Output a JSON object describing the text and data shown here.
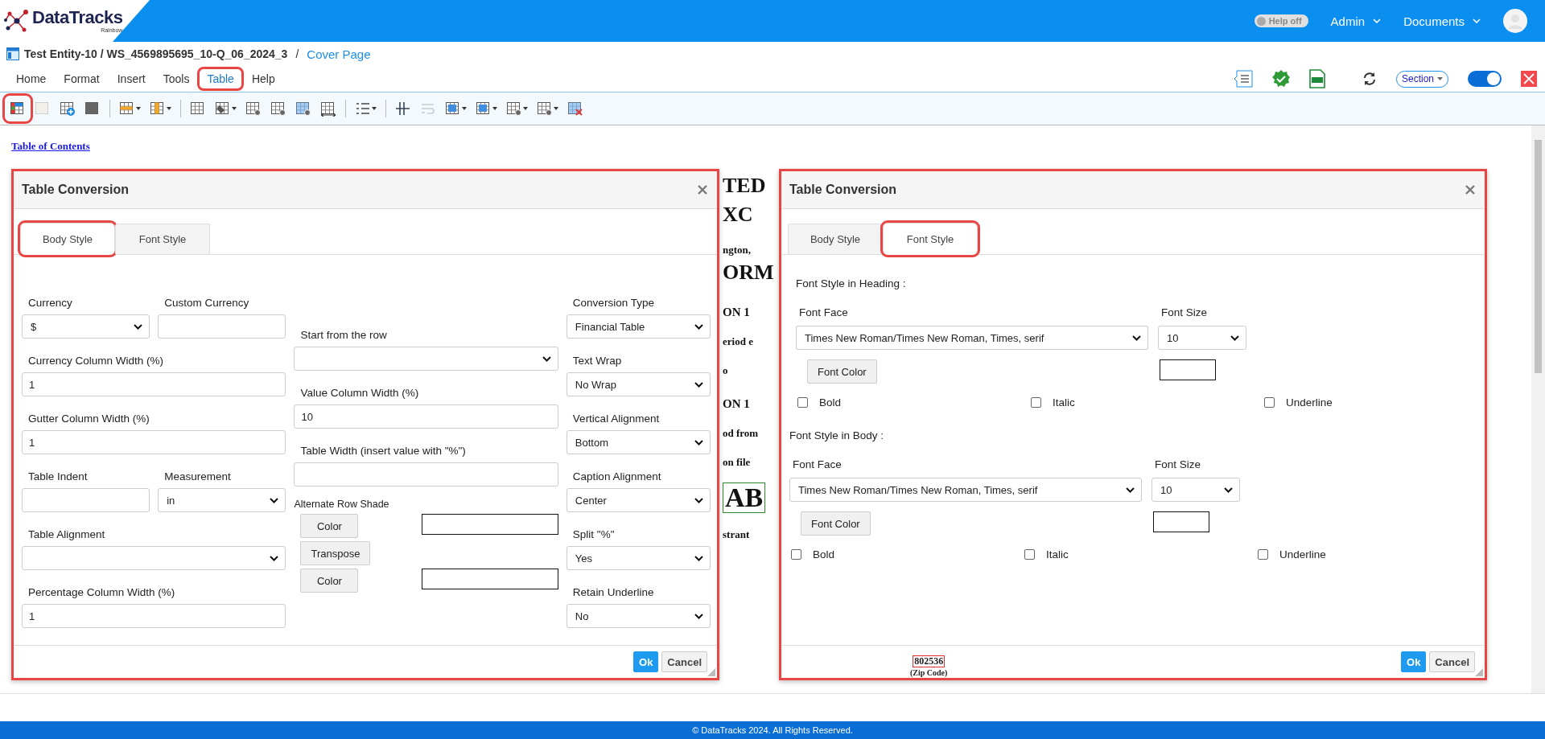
{
  "header": {
    "logo": "DataTracks",
    "logo_sub": "Rainbow",
    "help_toggle": {
      "label": "Help off",
      "on": false
    },
    "menus": [
      "Admin",
      "Documents"
    ]
  },
  "breadcrumb": {
    "path": "Test Entity-10 / WS_4569895695_10-Q_06_2024_3",
    "separator": "/",
    "current": "Cover Page"
  },
  "menu": [
    {
      "label": "Home",
      "selected": false,
      "annotated": false
    },
    {
      "label": "Format",
      "selected": false,
      "annotated": false
    },
    {
      "label": "Insert",
      "selected": false,
      "annotated": false
    },
    {
      "label": "Tools",
      "selected": false,
      "annotated": false
    },
    {
      "label": "Table",
      "selected": true,
      "annotated": true
    },
    {
      "label": "Help",
      "selected": false,
      "annotated": false
    }
  ],
  "right_tools": {
    "section": "Section",
    "toggle_on": true
  },
  "toolbar": {
    "groups": [
      [
        {
          "dropdown": false,
          "disabled": false,
          "annotated": true
        },
        {
          "dropdown": false,
          "disabled": true,
          "annotated": false
        },
        {
          "dropdown": false,
          "disabled": false,
          "annotated": false
        },
        {
          "dropdown": false,
          "disabled": false,
          "annotated": false
        }
      ],
      [
        {
          "dropdown": true,
          "disabled": false,
          "annotated": false
        },
        {
          "dropdown": true,
          "disabled": false,
          "annotated": false
        }
      ],
      [
        {
          "dropdown": false,
          "disabled": false,
          "annotated": false
        },
        {
          "dropdown": true,
          "disabled": false,
          "annotated": false
        },
        {
          "dropdown": false,
          "disabled": false,
          "annotated": false
        },
        {
          "dropdown": false,
          "disabled": false,
          "annotated": false
        },
        {
          "dropdown": false,
          "disabled": false,
          "annotated": false
        },
        {
          "dropdown": false,
          "disabled": false,
          "annotated": false
        }
      ],
      [
        {
          "dropdown": true,
          "disabled": false,
          "annotated": false
        }
      ],
      [
        {
          "dropdown": false,
          "disabled": false,
          "annotated": false
        },
        {
          "dropdown": false,
          "disabled": true,
          "annotated": false
        },
        {
          "dropdown": true,
          "disabled": false,
          "annotated": false
        },
        {
          "dropdown": true,
          "disabled": false,
          "annotated": false
        },
        {
          "dropdown": true,
          "disabled": false,
          "annotated": false
        },
        {
          "dropdown": true,
          "disabled": false,
          "annotated": false
        },
        {
          "dropdown": false,
          "disabled": false,
          "annotated": false
        }
      ]
    ]
  },
  "document": {
    "toc_link": "Table of Contents",
    "fragments": [
      {
        "text": "TED",
        "kind": "title"
      },
      {
        "text": "XC",
        "kind": "title"
      },
      {
        "text": "ngton,",
        "kind": "line"
      },
      {
        "text": "ORM",
        "kind": "title"
      },
      {
        "text": "ON 1",
        "kind": "subtitle"
      },
      {
        "text": "eriod e",
        "kind": "line"
      },
      {
        "text": "o",
        "kind": "line"
      },
      {
        "text": "ON 1",
        "kind": "subtitle"
      },
      {
        "text": "od from",
        "kind": "line"
      },
      {
        "text": "on file",
        "kind": "line"
      },
      {
        "text": "AB",
        "kind": "boxed"
      },
      {
        "text": "strant",
        "kind": "line"
      }
    ],
    "zip": "802536",
    "zip_label": "(Zip Code)"
  },
  "dialogs": [
    {
      "kind": "body",
      "title": "Table Conversion",
      "annotated": true,
      "tabs": [
        {
          "label": "Body Style",
          "selected": true,
          "annotated": true
        },
        {
          "label": "Font Style",
          "selected": false,
          "annotated": false
        }
      ],
      "columns": [
        [
          [
            {
              "kind": "select",
              "label": "Currency",
              "value": "$"
            },
            {
              "kind": "input",
              "label": "Custom Currency"
            }
          ],
          [
            {
              "kind": "input",
              "label": "Currency Column Width (%)",
              "value": "1"
            }
          ],
          [
            {
              "kind": "input",
              "label": "Gutter Column Width (%)",
              "value": "1"
            }
          ],
          [
            {
              "kind": "input",
              "label": "Table Indent"
            },
            {
              "kind": "select",
              "label": "Measurement",
              "value": "in"
            }
          ],
          [
            {
              "kind": "select",
              "label": "Table Alignment"
            }
          ],
          [
            {
              "kind": "input",
              "label": "Percentage Column Width (%)",
              "value": "1"
            }
          ]
        ],
        [
          [
            {
              "kind": "select",
              "label": "Start from the row"
            }
          ],
          [
            {
              "kind": "input",
              "label": "Value Column Width (%)",
              "value": "10"
            }
          ],
          [
            {
              "kind": "input",
              "label": "Table Width (insert value with \"%\")"
            }
          ],
          [
            {
              "kind": "caption",
              "label": "Alternate Row Shade"
            }
          ],
          [
            {
              "kind": "button",
              "value": "Color"
            },
            {
              "kind": "swatch"
            }
          ],
          [
            {
              "kind": "button",
              "value": "Transpose"
            }
          ],
          [
            {
              "kind": "button",
              "value": "Color"
            },
            {
              "kind": "swatch"
            }
          ]
        ],
        [
          [
            {
              "kind": "select",
              "label": "Conversion Type",
              "value": "Financial Table"
            }
          ],
          [
            {
              "kind": "select",
              "label": "Text Wrap",
              "value": "No Wrap"
            }
          ],
          [
            {
              "kind": "select",
              "label": "Vertical Alignment",
              "value": "Bottom"
            }
          ],
          [
            {
              "kind": "select",
              "label": "Caption Alignment",
              "value": "Center"
            }
          ],
          [
            {
              "kind": "select",
              "label": "Split \"%\"",
              "value": "Yes"
            }
          ],
          [
            {
              "kind": "select",
              "label": "Retain Underline",
              "value": "No"
            }
          ]
        ]
      ],
      "buttons": [
        {
          "label": "Ok",
          "kind": "primary"
        },
        {
          "label": "Cancel",
          "kind": "default"
        }
      ]
    },
    {
      "kind": "font",
      "title": "Table Conversion",
      "annotated": true,
      "tabs": [
        {
          "label": "Body Style",
          "selected": false,
          "annotated": false
        },
        {
          "label": "Font Style",
          "selected": true,
          "annotated": true
        }
      ],
      "sections": [
        {
          "heading": "Font Style in Heading :",
          "face_label": "Font Face",
          "face": "Times New Roman/Times New Roman, Times, serif",
          "size_label": "Font Size",
          "size": "10",
          "color_button": "Font Color",
          "checks": [
            {
              "label": "Bold",
              "checked": false
            },
            {
              "label": "Italic",
              "checked": false
            },
            {
              "label": "Underline",
              "checked": false
            }
          ]
        },
        {
          "heading": "Font Style in Body :",
          "face_label": "Font Face",
          "face": "Times New Roman/Times New Roman, Times, serif",
          "size_label": "Font Size",
          "size": "10",
          "color_button": "Font Color",
          "checks": [
            {
              "label": "Bold",
              "checked": false
            },
            {
              "label": "Italic",
              "checked": false
            },
            {
              "label": "Underline",
              "checked": false
            }
          ]
        }
      ],
      "buttons": [
        {
          "label": "Ok",
          "kind": "primary"
        },
        {
          "label": "Cancel",
          "kind": "default"
        }
      ]
    }
  ],
  "footer": "© DataTracks 2024. All Rights Reserved."
}
